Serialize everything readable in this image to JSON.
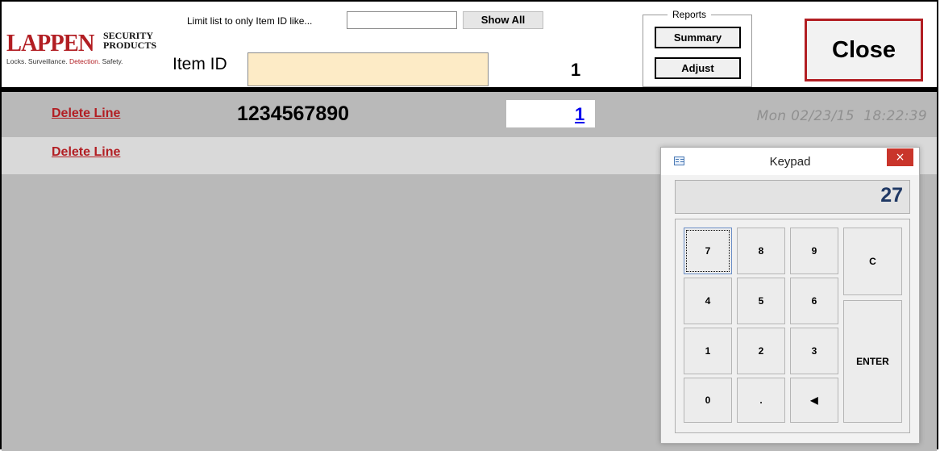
{
  "header": {
    "logo": {
      "brand": "LAPPEN",
      "brand_sub_1": "SECURITY",
      "brand_sub_2": "PRODUCTS",
      "tagline_a": "Locks. Surveillance. ",
      "tagline_b": "Detection.",
      "tagline_c": " Safety."
    },
    "limit_label": "Limit list to only Item ID like...",
    "limit_input_value": "",
    "show_all_label": "Show All",
    "item_id_label": "Item ID",
    "item_id_value": "",
    "count": "1",
    "reports": {
      "legend": "Reports",
      "summary_label": "Summary",
      "adjust_label": "Adjust"
    },
    "close_label": "Close"
  },
  "rows": [
    {
      "delete_label": "Delete Line",
      "item_code": "1234567890",
      "qty": "1",
      "timestamp": "Mon 02/23/15  18:22:39"
    },
    {
      "delete_label": "Delete Line"
    }
  ],
  "keypad": {
    "title": "Keypad",
    "close_glyph": "×",
    "display_value": "27",
    "keys": {
      "k7": "7",
      "k8": "8",
      "k9": "9",
      "clear": "C",
      "k4": "4",
      "k5": "5",
      "k6": "6",
      "k1": "1",
      "k2": "2",
      "k3": "3",
      "enter": "ENTER",
      "k0": "0",
      "dot": ".",
      "back": "◀"
    }
  },
  "colors": {
    "brand_red": "#b21e23",
    "item_id_bg": "#fdebc6",
    "link_blue": "#0000ee",
    "display_text": "#1f3864"
  }
}
